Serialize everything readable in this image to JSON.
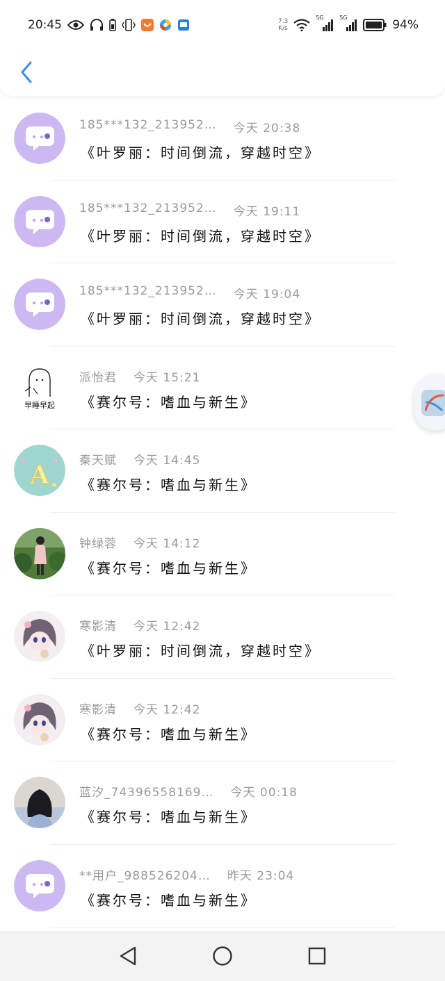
{
  "status_bar": {
    "time": "20:45",
    "net_speed_value": "7.3",
    "net_speed_unit": "K/s",
    "sim1_tag": "5G",
    "sim2_tag": "5G",
    "battery": "94%"
  },
  "header": {
    "back_icon": "chevron-left-icon",
    "accent": "#3a8ee6"
  },
  "items": [
    {
      "user": "185***132_213952…",
      "time": "今天 20:38",
      "work": "《叶罗丽：时间倒流，穿越时空》",
      "avatar": "default-chat"
    },
    {
      "user": "185***132_213952…",
      "time": "今天 19:11",
      "work": "《叶罗丽：时间倒流，穿越时空》",
      "avatar": "default-chat"
    },
    {
      "user": "185***132_213952…",
      "time": "今天 19:04",
      "work": "《叶罗丽：时间倒流，穿越时空》",
      "avatar": "default-chat"
    },
    {
      "user": "派怡君",
      "time": "今天 15:21",
      "work": "《赛尔号：嗜血与新生》",
      "avatar": "sketch",
      "avatar_text": "早睡早起"
    },
    {
      "user": "秦天赋",
      "time": "今天 14:45",
      "work": "《赛尔号：嗜血与新生》",
      "avatar": "letter-a",
      "avatar_text": "A"
    },
    {
      "user": "钟绿蓉",
      "time": "今天 14:12",
      "work": "《赛尔号：嗜血与新生》",
      "avatar": "photo-person"
    },
    {
      "user": "寒影清",
      "time": "今天 12:42",
      "work": "《叶罗丽：时间倒流，穿越时空》",
      "avatar": "anime-girl"
    },
    {
      "user": "寒影清",
      "time": "今天 12:42",
      "work": "《赛尔号：嗜血与新生》",
      "avatar": "anime-girl"
    },
    {
      "user": "蓝汐_74396558169…",
      "time": "今天 00:18",
      "work": "《赛尔号：嗜血与新生》",
      "avatar": "photo-back"
    },
    {
      "user": "**用户_988526204…",
      "time": "昨天 23:04",
      "work": "《赛尔号：嗜血与新生》",
      "avatar": "default-chat"
    }
  ],
  "floating_button": {
    "icon": "float-app-icon"
  },
  "nav_bar": {
    "back": "triangle-back-icon",
    "home": "circle-home-icon",
    "recents": "square-recents-icon"
  },
  "colors": {
    "avatar_purple": "#cdb9f2",
    "meta_gray": "#9a9a9a"
  }
}
